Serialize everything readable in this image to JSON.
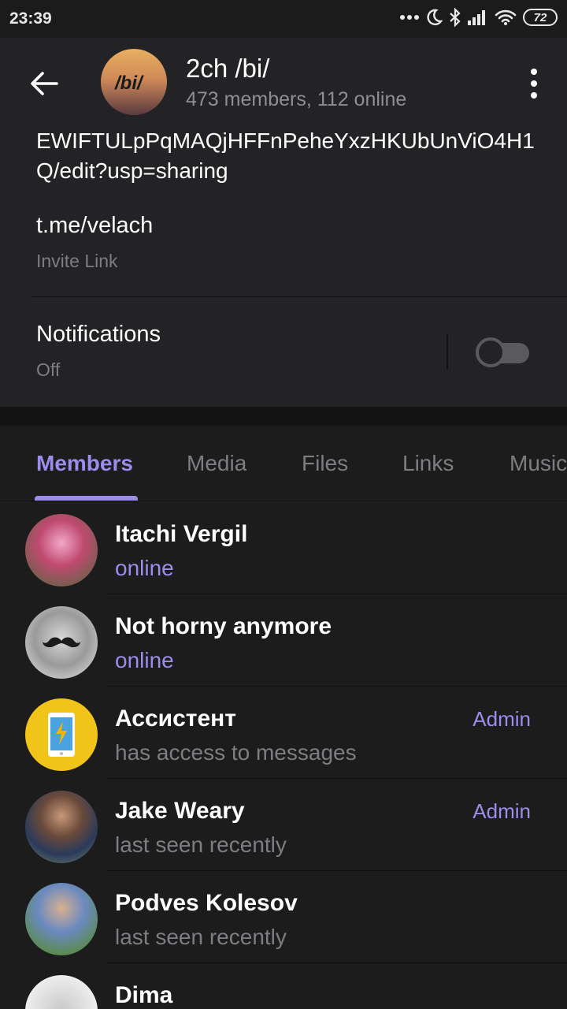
{
  "status_bar": {
    "time": "23:39",
    "battery": "72",
    "icons": [
      "dots-icon",
      "moon-icon",
      "bluetooth-icon",
      "signal-icon",
      "wifi-icon"
    ]
  },
  "header": {
    "title": "2ch /bi/",
    "subtitle": "473 members, 112 online",
    "avatar_text": "/bi/"
  },
  "info": {
    "description": "EWIFTULpPqMAQjHFFnPeheYxzHKUbUnViO4H1Q/edit?usp=sharing",
    "invite_link": "t.me/velach",
    "invite_link_caption": "Invite Link",
    "notifications_label": "Notifications",
    "notifications_value": "Off"
  },
  "tabs": [
    {
      "label": "Members"
    },
    {
      "label": "Media"
    },
    {
      "label": "Files"
    },
    {
      "label": "Links"
    },
    {
      "label": "Music"
    }
  ],
  "colors": {
    "accent": "#9d8cec",
    "background": "#1c1c1d",
    "card": "#232325",
    "secondary_text": "#7d7d82"
  },
  "members": [
    {
      "name": "Itachi Vergil",
      "status": "online",
      "badge": ""
    },
    {
      "name": "Not horny anymore",
      "status": "online",
      "badge": ""
    },
    {
      "name": "Ассистент",
      "status": "has access to messages",
      "badge": "Admin"
    },
    {
      "name": "Jake Weary",
      "status": "last seen recently",
      "badge": "Admin"
    },
    {
      "name": "Podves Kolesov",
      "status": "last seen recently",
      "badge": ""
    },
    {
      "name": "Dima",
      "status": "",
      "badge": ""
    }
  ]
}
